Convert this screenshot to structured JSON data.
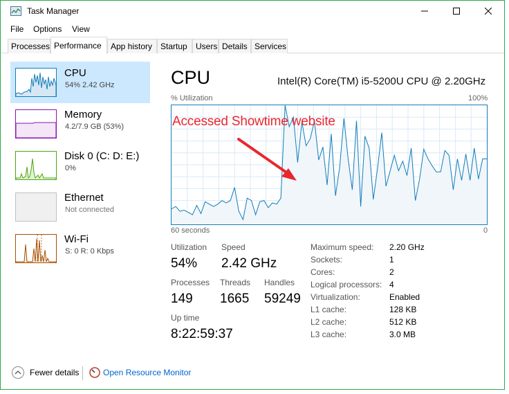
{
  "window": {
    "title": "Task Manager"
  },
  "menu": [
    "File",
    "Options",
    "View"
  ],
  "tabs": [
    "Processes",
    "Performance",
    "App history",
    "Startup",
    "Users",
    "Details",
    "Services"
  ],
  "sidebar": {
    "items": [
      {
        "name": "CPU",
        "sub": "54%  2.42 GHz"
      },
      {
        "name": "Memory",
        "sub": "4.2/7.9 GB (53%)"
      },
      {
        "name": "Disk 0 (C: D: E:)",
        "sub": "0%"
      },
      {
        "name": "Ethernet",
        "sub": "Not connected"
      },
      {
        "name": "Wi-Fi",
        "sub": "S: 0 R: 0 Kbps"
      }
    ]
  },
  "main": {
    "title": "CPU",
    "model": "Intel(R) Core(TM) i5-5200U CPU @ 2.20GHz",
    "graph_label": "% Utilization",
    "graph_max": "100%",
    "graph_time": "60 seconds",
    "graph_min": "0",
    "annotation": "Accessed Showtime website",
    "stats": {
      "utilization_label": "Utilization",
      "utilization": "54%",
      "speed_label": "Speed",
      "speed": "2.42 GHz",
      "processes_label": "Processes",
      "processes": "149",
      "threads_label": "Threads",
      "threads": "1665",
      "handles_label": "Handles",
      "handles": "59249",
      "uptime_label": "Up time",
      "uptime": "8:22:59:37"
    },
    "specs": [
      {
        "label": "Maximum speed:",
        "value": "2.20 GHz"
      },
      {
        "label": "Sockets:",
        "value": "1"
      },
      {
        "label": "Cores:",
        "value": "2"
      },
      {
        "label": "Logical processors:",
        "value": "4"
      },
      {
        "label": "Virtualization:",
        "value": "Enabled"
      },
      {
        "label": "L1 cache:",
        "value": "128 KB"
      },
      {
        "label": "L2 cache:",
        "value": "512 KB"
      },
      {
        "label": "L3 cache:",
        "value": "3.0 MB"
      }
    ]
  },
  "footer": {
    "fewer_details": "Fewer details",
    "open_monitor": "Open Resource Monitor"
  },
  "cpu_history": [
    13,
    15,
    11,
    12,
    10,
    8,
    16,
    9,
    19,
    17,
    15,
    17,
    20,
    18,
    20,
    31,
    11,
    4,
    22,
    20,
    8,
    19,
    20,
    14,
    18,
    17,
    22,
    100,
    82,
    90,
    52,
    86,
    66,
    72,
    87,
    54,
    65,
    33,
    76,
    24,
    48,
    89,
    55,
    29,
    87,
    15,
    74,
    64,
    21,
    47,
    77,
    32,
    45,
    58,
    45,
    53,
    41,
    64,
    20,
    38,
    63,
    55,
    49,
    44,
    44,
    62,
    58,
    29,
    55,
    37,
    59,
    37,
    64,
    38,
    55,
    55
  ],
  "colors": {
    "accent": "#117dbb",
    "fill": "#f1f6fa",
    "annotation": "#e8272f",
    "selected": "#cce8ff",
    "link": "#0066cc"
  }
}
